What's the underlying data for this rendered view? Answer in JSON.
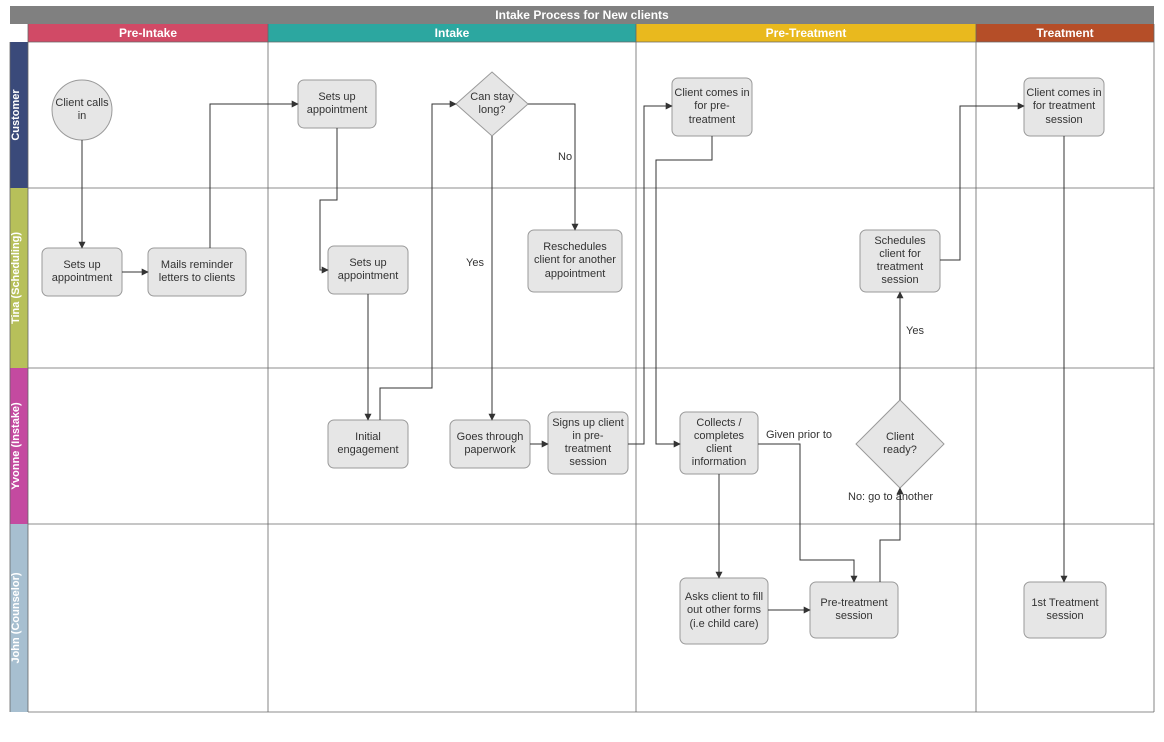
{
  "title": "Intake Process for New clients",
  "phases": [
    {
      "id": "pre-intake",
      "label": "Pre-Intake",
      "color": "#d14a66"
    },
    {
      "id": "intake",
      "label": "Intake",
      "color": "#2ca7a0"
    },
    {
      "id": "pre-treatment",
      "label": "Pre-Treatment",
      "color": "#e9b91e"
    },
    {
      "id": "treatment",
      "label": "Treatment",
      "color": "#b54e28"
    }
  ],
  "lanes": [
    {
      "id": "customer",
      "label": "Customer",
      "color": "#3a4a7a"
    },
    {
      "id": "tina",
      "label": "Tina (Scheduling)",
      "color": "#b7c05a"
    },
    {
      "id": "yvonne",
      "label": "Yvonne (Instake)",
      "color": "#c44aa0"
    },
    {
      "id": "john",
      "label": "John (Counselor)",
      "color": "#a7bfd0"
    }
  ],
  "nodes": {
    "client_calls_in": "Client calls in",
    "sets_up_appt_tina1": "Sets up appointment",
    "mails_reminder": "Mails reminder letters to clients",
    "sets_up_appt_cust": "Sets up appointment",
    "sets_up_appt_tina2": "Sets up appointment",
    "can_stay_long": "Can stay long?",
    "reschedules": "Reschedules client for another appointment",
    "initial_engagement": "Initial engagement",
    "goes_through_paperwork": "Goes through paperwork",
    "signs_up_pretreatment": "Signs up client in pre-treatment session",
    "client_comes_pretreatment": "Client comes in for pre-treatment",
    "collects_info": "Collects / completes client information",
    "client_ready": "Client ready?",
    "asks_forms": "Asks client to fill out other forms (i.e child care)",
    "pre_treatment_session": "Pre-treatment session",
    "schedules_treatment": "Schedules client for treatment session",
    "client_comes_treatment": "Client comes in for treatment session",
    "first_treatment": "1st Treatment session"
  },
  "edge_labels": {
    "no": "No",
    "yes": "Yes",
    "given_prior": "Given prior to",
    "yes2": "Yes",
    "no_go_another": "No: go to another"
  }
}
